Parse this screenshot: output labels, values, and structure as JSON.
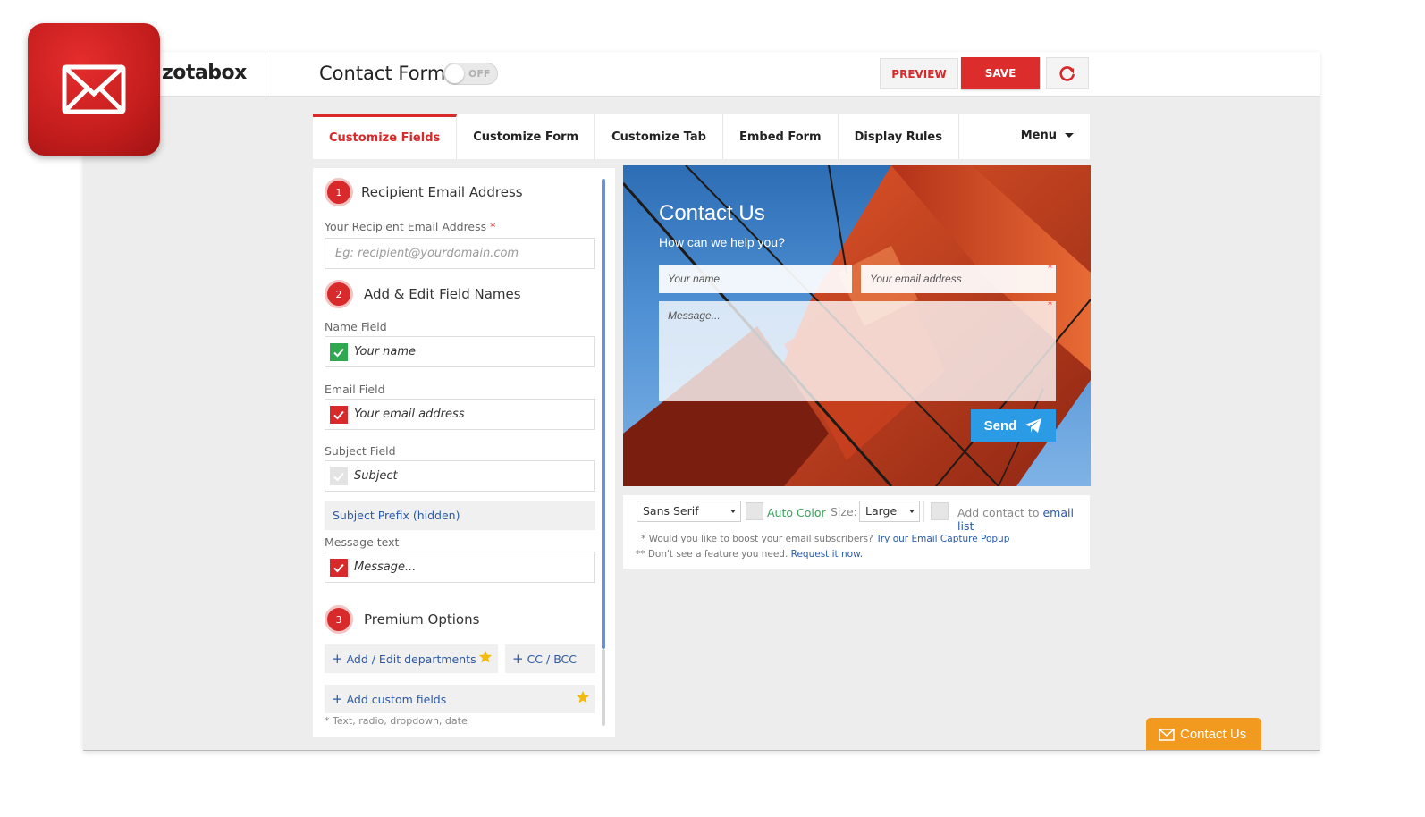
{
  "app": {
    "brand": "zotabox",
    "page_title": "Contact Form",
    "toggle_label": "OFF",
    "preview_label": "PREVIEW",
    "save_label": "SAVE"
  },
  "tabs": [
    {
      "label": "Customize Fields",
      "active": true
    },
    {
      "label": "Customize Form"
    },
    {
      "label": "Customize Tab"
    },
    {
      "label": "Embed Form"
    },
    {
      "label": "Display Rules"
    }
  ],
  "menu_label": "Menu",
  "fields": {
    "step1": {
      "num": "1",
      "title": "Recipient Email Address"
    },
    "recipient_label": "Your Recipient Email Address",
    "recipient_required": "*",
    "recipient_placeholder": "Eg: recipient@yourdomain.com",
    "step2": {
      "num": "2",
      "title": "Add & Edit Field Names"
    },
    "name_label": "Name Field",
    "name_value": "Your name",
    "email_label": "Email Field",
    "email_value": "Your email address",
    "subject_label": "Subject Field",
    "subject_value": "Subject",
    "subject_prefix": "Subject Prefix (hidden)",
    "message_label": "Message text",
    "message_value": "Message...",
    "step3": {
      "num": "3",
      "title": "Premium Options"
    },
    "departments": "Add / Edit departments",
    "ccbcc": "CC / BCC",
    "custom_fields": "Add custom fields",
    "custom_note": "* Text, radio, dropdown, date"
  },
  "form_preview": {
    "title": "Contact Us",
    "subtitle": "How can we help you?",
    "name_placeholder": "Your name",
    "email_placeholder": "Your email address",
    "message_placeholder": "Message...",
    "send_label": "Send"
  },
  "options": {
    "font": "Sans Serif",
    "auto_color": "Auto Color",
    "size_label": "Size:",
    "size_value": "Large",
    "add_contact_text": "Add contact to",
    "email_list": "email list",
    "note1_text": "* Would you like to boost your email subscribers?",
    "note1_link": "Try our Email Capture Popup",
    "note2_text": "** Don't see a feature you need.",
    "note2_link": "Request it now."
  },
  "contact_tab": {
    "label": "Contact Us"
  },
  "colors": {
    "accent_red": "#d8292b",
    "link_blue": "#2a5aa8",
    "send_blue": "#2c9be6",
    "contact_orange": "#f19a1f",
    "check_green": "#2fa84f"
  }
}
